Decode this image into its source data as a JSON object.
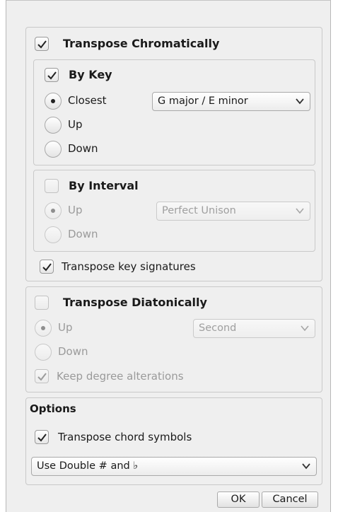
{
  "chromatic": {
    "title": "Transpose Chromatically",
    "checked": true,
    "by_key": {
      "title": "By Key",
      "checked": true,
      "options": [
        "Closest",
        "Up",
        "Down"
      ],
      "selected": "Closest",
      "key_value": "G major / E minor"
    },
    "by_interval": {
      "title": "By Interval",
      "checked": false,
      "options": [
        "Up",
        "Down"
      ],
      "selected": "Up",
      "interval_value": "Perfect Unison"
    },
    "key_signatures_label": "Transpose key signatures",
    "key_signatures_checked": true
  },
  "diatonic": {
    "title": "Transpose Diatonically",
    "checked": false,
    "options": [
      "Up",
      "Down"
    ],
    "selected": "Up",
    "degree_value": "Second",
    "keep_alterations_label": "Keep degree alterations",
    "keep_alterations_checked": true
  },
  "options_group": {
    "title": "Options",
    "chord_symbols_label": "Transpose chord symbols",
    "chord_symbols_checked": true,
    "accidentals_value": "Use Double # and ♭"
  },
  "buttons": {
    "ok": "OK",
    "cancel": "Cancel"
  },
  "icons": {
    "checkmark": "checkmark-icon",
    "chevron": "chevron-down-icon"
  }
}
